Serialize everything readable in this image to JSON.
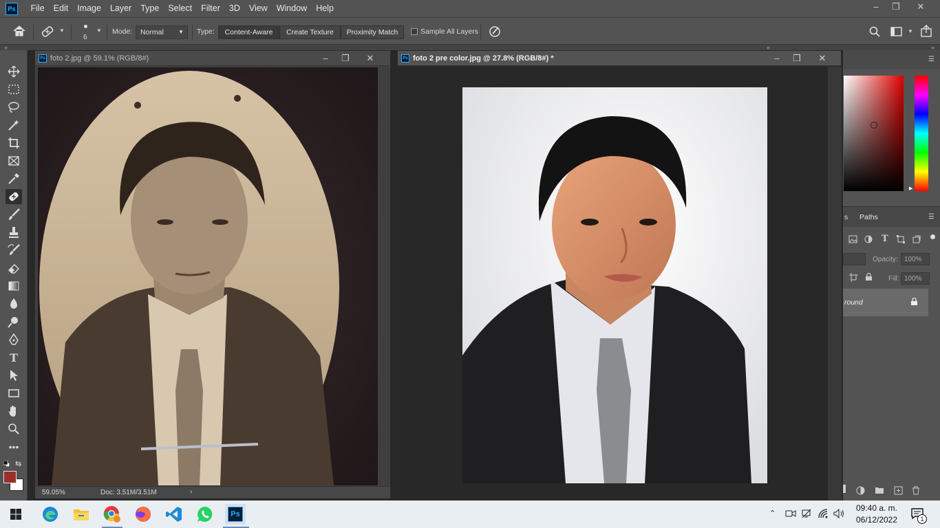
{
  "app": {
    "logo": "Ps",
    "menu": [
      "File",
      "Edit",
      "Image",
      "Layer",
      "Type",
      "Select",
      "Filter",
      "3D",
      "View",
      "Window",
      "Help"
    ],
    "window_controls": [
      "–",
      "❐",
      "✕"
    ]
  },
  "options_bar": {
    "brush_size": "6",
    "mode_label": "Mode:",
    "mode_value": "Normal",
    "type_label": "Type:",
    "type_options": [
      "Content-Aware",
      "Create Texture",
      "Proximity Match"
    ],
    "sample_all_layers": "Sample All Layers"
  },
  "documents": [
    {
      "title": "foto 2.jpg @ 59.1% (RGB/8#)",
      "zoom": "59.05%",
      "doc_size": "Doc: 3.51M/3.51M"
    },
    {
      "title": "foto 2 pre color.jpg @ 27.8% (RGB/8#) *"
    }
  ],
  "panels": {
    "paths_tab": "Paths",
    "tab_fragment": "s",
    "opacity_label": "Opacity:",
    "opacity_value": "100%",
    "fill_label": "Fill:",
    "fill_value": "100%",
    "layer_name": "round"
  },
  "colors": {
    "foreground": "#9a2f2a",
    "background": "#ffffff",
    "accent": "#31a8ff"
  },
  "taskbar": {
    "time": "09:40 a. m.",
    "date": "06/12/2022",
    "notification_count": "1"
  }
}
